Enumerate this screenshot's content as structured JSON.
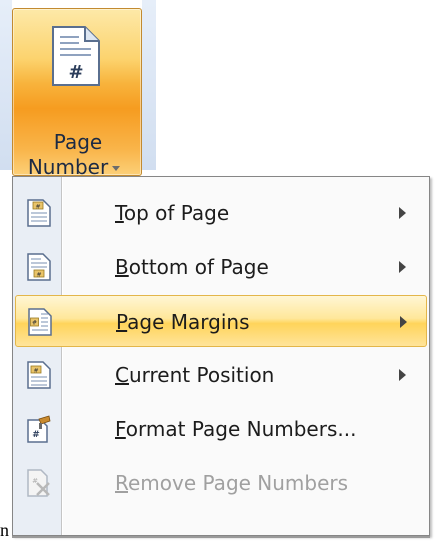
{
  "ribbon_button": {
    "label_line1": "Page",
    "label_line2": "Number",
    "icon": "page-number-document-icon",
    "icon_glyph": "#"
  },
  "menu": {
    "items": [
      {
        "label": "Top of Page",
        "accel": "T",
        "rest": "op of Page",
        "icon": "top-of-page-icon",
        "has_submenu": true,
        "disabled": false,
        "highlighted": false
      },
      {
        "label": "Bottom of Page",
        "accel": "B",
        "rest": "ottom of Page",
        "icon": "bottom-of-page-icon",
        "has_submenu": true,
        "disabled": false,
        "highlighted": false
      },
      {
        "label": "Page Margins",
        "accel": "P",
        "rest": "age Margins",
        "icon": "page-margins-icon",
        "has_submenu": true,
        "disabled": false,
        "highlighted": true
      },
      {
        "label": "Current Position",
        "accel": "C",
        "rest": "urrent Position",
        "icon": "current-position-icon",
        "has_submenu": true,
        "disabled": false,
        "highlighted": false
      },
      {
        "label": "Format Page Numbers...",
        "accel": "F",
        "rest": "ormat Page Numbers...",
        "icon": "format-page-numbers-icon",
        "has_submenu": false,
        "disabled": false,
        "highlighted": false
      },
      {
        "label": "Remove Page Numbers",
        "accel": "R",
        "rest": "emove Page Numbers",
        "icon": "remove-page-numbers-icon",
        "has_submenu": false,
        "disabled": true,
        "highlighted": false
      }
    ]
  },
  "stray_text": "n",
  "colors": {
    "button_orange": "#f69c20",
    "highlight_yellow": "#ffe79a",
    "menu_border": "#868686",
    "disabled_text": "#a0a0a0"
  }
}
